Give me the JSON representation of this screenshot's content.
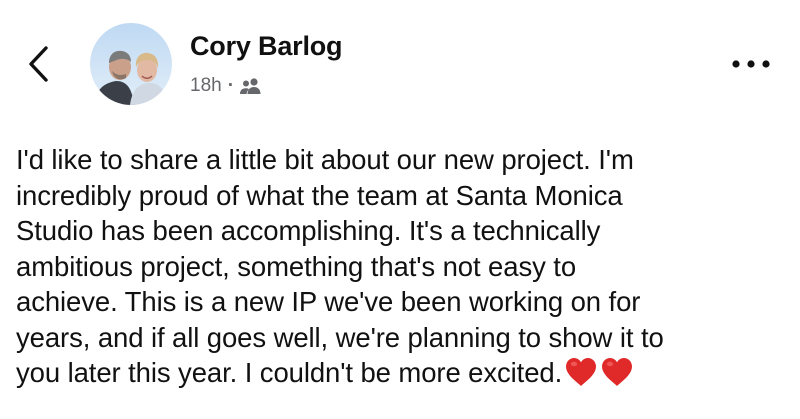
{
  "post": {
    "author": "Cory Barlog",
    "timestamp": "18h",
    "separator": "·",
    "audience_icon": "friends-icon",
    "back_icon": "chevron-left-icon",
    "more_icon": "more-horizontal-icon",
    "text_lines": [
      "I'd like to share a little bit about our new project. I'm",
      "incredibly proud of what the team at Santa Monica",
      "Studio has been accomplishing. It's a technically",
      "ambitious project, something that's not easy to",
      "achieve. This is a new IP we've been working on for",
      "years, and if all goes well, we're planning to show it to",
      "you later this year. I couldn't be more excited."
    ],
    "emoji": [
      "red-heart",
      "red-heart"
    ]
  },
  "colors": {
    "text": "#111111",
    "meta": "#65676b",
    "heart": "#e02a2a"
  }
}
